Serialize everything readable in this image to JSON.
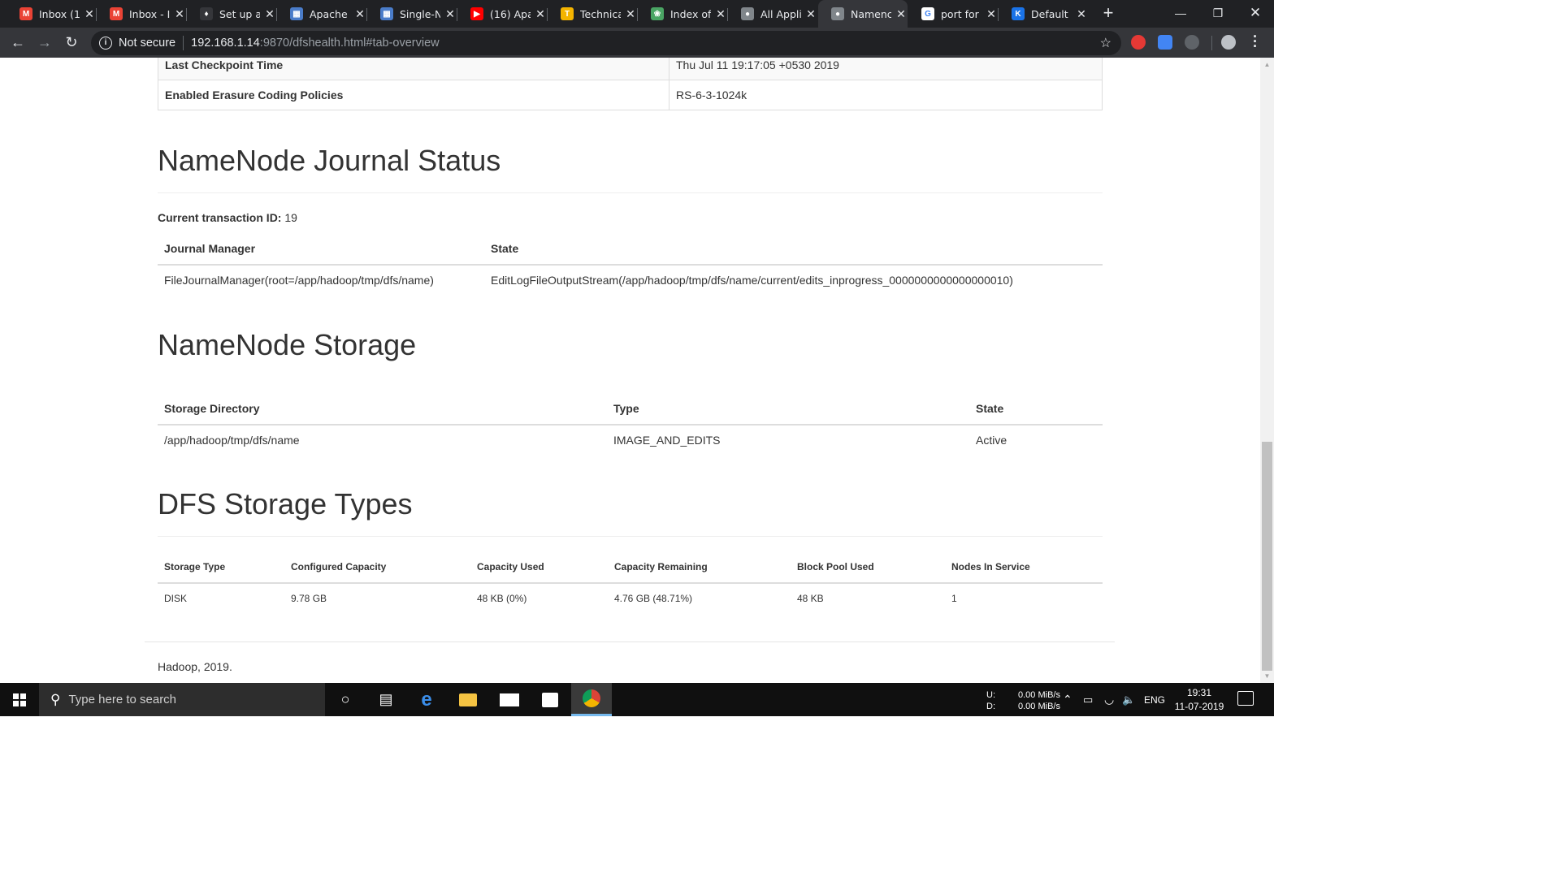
{
  "browser": {
    "tabs": [
      {
        "label": "Inbox (1",
        "icon": "gmail-icon",
        "color": "#ea4335",
        "glyph": "M"
      },
      {
        "label": "Inbox - I",
        "icon": "gmail-icon",
        "color": "#ea4335",
        "glyph": "M"
      },
      {
        "label": "Set up a",
        "icon": "drop-icon",
        "color": "#35363a",
        "glyph": "♦"
      },
      {
        "label": "Apache",
        "icon": "grid-icon",
        "color": "#4a7cc9",
        "glyph": "▦"
      },
      {
        "label": "Single-N",
        "icon": "grid-icon",
        "color": "#4a7cc9",
        "glyph": "▦"
      },
      {
        "label": "(16) Apa",
        "icon": "youtube-icon",
        "color": "#ff0000",
        "glyph": "▶"
      },
      {
        "label": "Technica",
        "icon": "hadoop-logo-icon",
        "color": "#f4b400",
        "glyph": "T"
      },
      {
        "label": "Index of",
        "icon": "apache-feather-icon",
        "color": "#4aa564",
        "glyph": "❀"
      },
      {
        "label": "All Appli",
        "icon": "globe-icon",
        "color": "#80868b",
        "glyph": "●"
      },
      {
        "label": "Namenc",
        "icon": "globe-icon",
        "color": "#80868b",
        "glyph": "●"
      },
      {
        "label": "port for",
        "icon": "google-icon",
        "color": "#ffffff",
        "glyph": "G"
      },
      {
        "label": "Default",
        "icon": "k-icon",
        "color": "#1a73e8",
        "glyph": "K"
      }
    ],
    "active_tab": 9,
    "security_label": "Not secure",
    "url_host": "192.168.1.14",
    "url_path": ":9870/dfshealth.html#tab-overview"
  },
  "overview_rows": [
    {
      "key": "Last Checkpoint Time",
      "value": "Thu Jul 11 19:17:05 +0530 2019"
    },
    {
      "key": "Enabled Erasure Coding Policies",
      "value": "RS-6-3-1024k"
    }
  ],
  "journal": {
    "title": "NameNode Journal Status",
    "txid_label": "Current transaction ID:",
    "txid_value": "19",
    "headers": [
      "Journal Manager",
      "State"
    ],
    "rows": [
      [
        "FileJournalManager(root=/app/hadoop/tmp/dfs/name)",
        "EditLogFileOutputStream(/app/hadoop/tmp/dfs/name/current/edits_inprogress_0000000000000000010)"
      ]
    ]
  },
  "storage": {
    "title": "NameNode Storage",
    "headers": [
      "Storage Directory",
      "Type",
      "State"
    ],
    "rows": [
      [
        "/app/hadoop/tmp/dfs/name",
        "IMAGE_AND_EDITS",
        "Active"
      ]
    ]
  },
  "dfs_types": {
    "title": "DFS Storage Types",
    "headers": [
      "Storage Type",
      "Configured Capacity",
      "Capacity Used",
      "Capacity Remaining",
      "Block Pool Used",
      "Nodes In Service"
    ],
    "rows": [
      [
        "DISK",
        "9.78 GB",
        "48 KB (0%)",
        "4.76 GB (48.71%)",
        "48 KB",
        "1"
      ]
    ]
  },
  "footer": "Hadoop, 2019.",
  "taskbar": {
    "search_placeholder": "Type here to search",
    "net_up_label": "U:",
    "net_down_label": "D:",
    "net_up": "0.00 MiB/s",
    "net_down": "0.00 MiB/s",
    "lang": "ENG",
    "time": "19:31",
    "date": "11-07-2019"
  }
}
